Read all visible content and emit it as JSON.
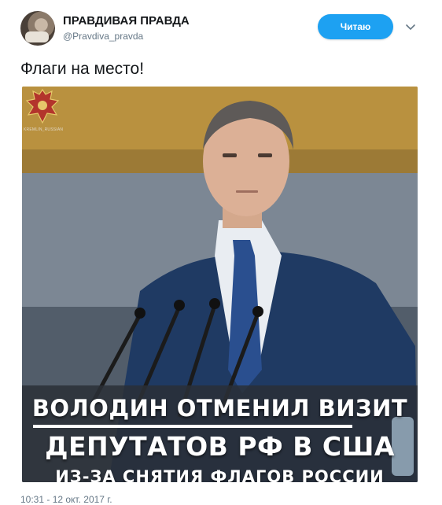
{
  "tweet": {
    "author_name": "ПРАВДИВАЯ ПРАВДА",
    "author_handle": "@Pravdiva_pravda",
    "follow_label": "Читаю",
    "text": "Флаги на место!",
    "timestamp": "10:31 - 12 окт. 2017 г."
  },
  "media": {
    "watermark": "KREMLIN_RUSSIAN",
    "caption_line1": "ВОЛОДИН ОТМЕНИЛ ВИЗИТ",
    "caption_line2": "ДЕПУТАТОВ РФ В США",
    "caption_line3": "ИЗ-ЗА СНЯТИЯ ФЛАГОВ РОССИИ"
  },
  "colors": {
    "accent": "#1da1f2",
    "text": "#14171a",
    "muted": "#657786"
  },
  "icons": {
    "more": "chevron-down-icon",
    "emblem": "coat-of-arms-icon"
  }
}
